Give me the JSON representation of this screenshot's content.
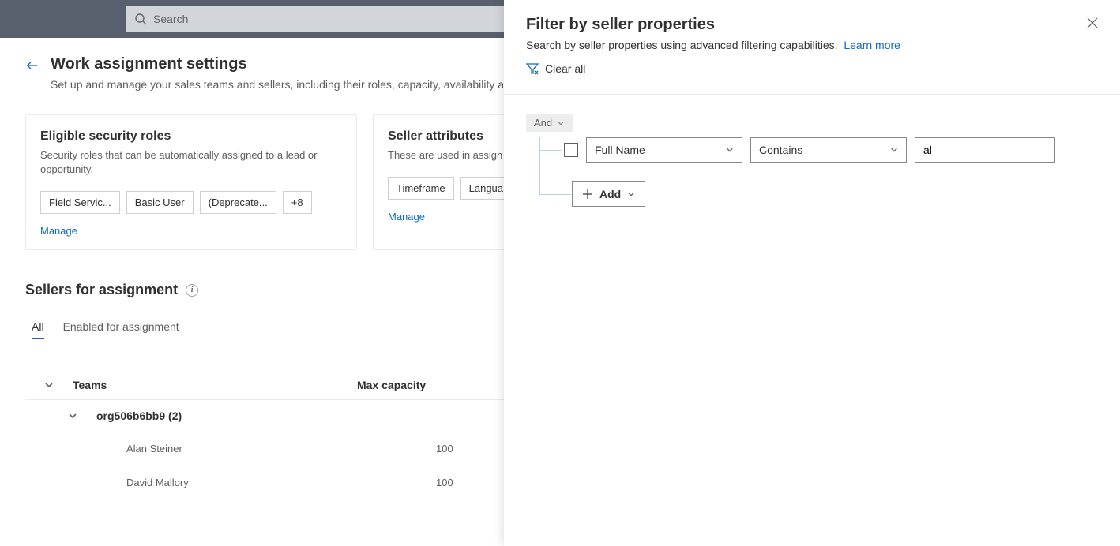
{
  "topbar": {
    "search_placeholder": "Search"
  },
  "header": {
    "title": "Work assignment settings",
    "subtitle": "Set up and manage your sales teams and sellers, including their roles, capacity, availability a"
  },
  "cards": {
    "roles": {
      "title": "Eligible security roles",
      "subtitle": "Security roles that can be automatically assigned to a lead or opportunity.",
      "chips": [
        "Field Servic...",
        "Basic User",
        "(Deprecate...",
        "+8"
      ],
      "manage": "Manage"
    },
    "attrs": {
      "title": "Seller attributes",
      "subtitle": "These are used in assign",
      "chips": [
        "Timeframe",
        "Langua"
      ],
      "manage": "Manage"
    }
  },
  "sellers": {
    "title": "Sellers for assignment",
    "tabs": {
      "all": "All",
      "enabled": "Enabled for assignment"
    },
    "columns": {
      "teams": "Teams",
      "max": "Max capacity"
    },
    "group": "org506b6bb9 (2)",
    "rows": [
      {
        "name": "Alan Steiner",
        "cap": "100"
      },
      {
        "name": "David Mallory",
        "cap": "100"
      }
    ]
  },
  "panel": {
    "title": "Filter by seller properties",
    "subtitle_text": "Search by seller properties using advanced filtering capabilities.",
    "learn_more": "Learn more",
    "clear": "Clear all",
    "and": "And",
    "cond": {
      "field": "Full Name",
      "op": "Contains",
      "value": "al"
    },
    "add": "Add"
  }
}
